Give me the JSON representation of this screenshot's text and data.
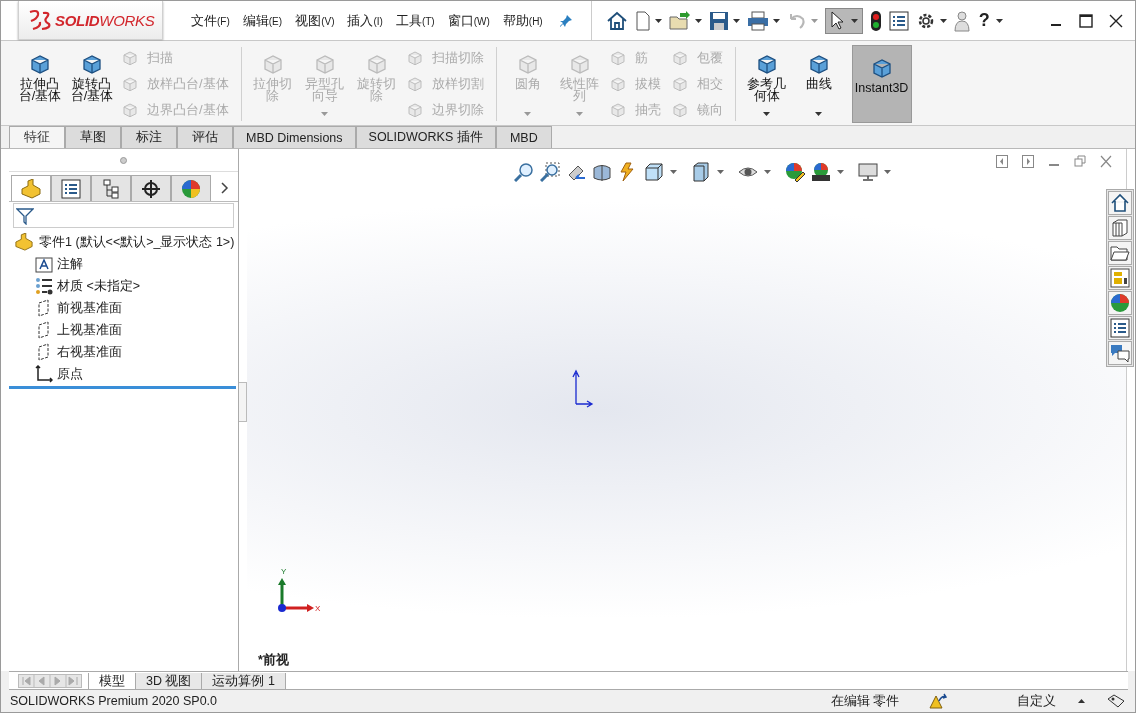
{
  "logo": "**SOLID**WORKS",
  "menu": [
    {
      "label": "文件",
      "key": "(F)"
    },
    {
      "label": "编辑",
      "key": "(E)"
    },
    {
      "label": "视图",
      "key": "(V)"
    },
    {
      "label": "插入",
      "key": "(I)"
    },
    {
      "label": "工具",
      "key": "(T)"
    },
    {
      "label": "窗口",
      "key": "(W)"
    },
    {
      "label": "帮助",
      "key": "(H)"
    }
  ],
  "quick_access": {
    "undo_disabled": true,
    "select_pressed": true,
    "help": "?"
  },
  "ribbon": [
    {
      "items": [
        {
          "kind": "large",
          "lines": [
            "拉伸凸",
            "台/基体"
          ],
          "disabled": false,
          "dropdown": false,
          "pressed": false
        },
        {
          "kind": "large",
          "lines": [
            "旋转凸",
            "台/基体"
          ],
          "disabled": false,
          "dropdown": false,
          "pressed": false
        },
        {
          "kind": "stack",
          "items": [
            {
              "label": "扫描",
              "disabled": true
            },
            {
              "label": "放样凸台/基体",
              "disabled": true
            },
            {
              "label": "边界凸台/基体",
              "disabled": true
            }
          ]
        }
      ]
    },
    {
      "items": [
        {
          "kind": "large",
          "lines": [
            "拉伸切",
            "除"
          ],
          "disabled": true,
          "dropdown": false,
          "pressed": false
        },
        {
          "kind": "large",
          "lines": [
            "异型孔",
            "向导"
          ],
          "disabled": true,
          "dropdown": true,
          "pressed": false
        },
        {
          "kind": "large",
          "lines": [
            "旋转切",
            "除"
          ],
          "disabled": true,
          "dropdown": false,
          "pressed": false
        },
        {
          "kind": "stack",
          "items": [
            {
              "label": "扫描切除",
              "disabled": true
            },
            {
              "label": "放样切割",
              "disabled": true
            },
            {
              "label": "边界切除",
              "disabled": true
            }
          ]
        }
      ]
    },
    {
      "items": [
        {
          "kind": "large",
          "lines": [
            "圆角"
          ],
          "disabled": true,
          "dropdown": true,
          "pressed": false
        },
        {
          "kind": "large",
          "lines": [
            "线性阵",
            "列"
          ],
          "disabled": true,
          "dropdown": true,
          "pressed": false
        },
        {
          "kind": "stack",
          "items": [
            {
              "label": "筋",
              "disabled": true
            },
            {
              "label": "拔模",
              "disabled": true
            },
            {
              "label": "抽壳",
              "disabled": true
            }
          ]
        },
        {
          "kind": "stack",
          "items": [
            {
              "label": "包覆",
              "disabled": true
            },
            {
              "label": "相交",
              "disabled": true
            },
            {
              "label": "镜向",
              "disabled": true
            }
          ]
        }
      ]
    },
    {
      "items": [
        {
          "kind": "large",
          "lines": [
            "参考几",
            "何体"
          ],
          "disabled": false,
          "dropdown": true,
          "pressed": false
        },
        {
          "kind": "large",
          "lines": [
            "曲线"
          ],
          "disabled": false,
          "dropdown": true,
          "pressed": false
        }
      ]
    },
    {
      "items": [
        {
          "kind": "large",
          "lines": [
            "Instant3D"
          ],
          "disabled": false,
          "dropdown": false,
          "pressed": true
        }
      ]
    }
  ],
  "tabs": [
    {
      "label": "特征",
      "selected": true
    },
    {
      "label": "草图",
      "selected": false
    },
    {
      "label": "标注",
      "selected": false
    },
    {
      "label": "评估",
      "selected": false
    },
    {
      "label": "MBD Dimensions",
      "selected": false
    },
    {
      "label": "SOLIDWORKS 插件",
      "selected": false
    },
    {
      "label": "MBD",
      "selected": false
    }
  ],
  "panel_tabs": [
    {
      "kind": "feature",
      "selected": true
    },
    {
      "kind": "property",
      "selected": false
    },
    {
      "kind": "config",
      "selected": false
    },
    {
      "kind": "dimxpert",
      "selected": false
    },
    {
      "kind": "display",
      "selected": false
    }
  ],
  "tree": {
    "label": "零件1  (默认<<默认>_显示状态 1>)",
    "children": [
      {
        "kind": "annotation",
        "label": "注解"
      },
      {
        "kind": "material",
        "label": "材质 <未指定>"
      },
      {
        "kind": "plane",
        "label": "前视基准面"
      },
      {
        "kind": "plane",
        "label": "上视基准面"
      },
      {
        "kind": "plane",
        "label": "右视基准面"
      },
      {
        "kind": "origin",
        "label": "原点"
      }
    ]
  },
  "viewport": {
    "view_label": "*前视",
    "triad": {
      "x": "X",
      "y": "Y"
    }
  },
  "bottom_tabs": [
    {
      "label": "模型",
      "selected": true
    },
    {
      "label": "3D 视图",
      "selected": false
    },
    {
      "label": "运动算例 1",
      "selected": false
    }
  ],
  "status_bar": {
    "product": "SOLIDWORKS Premium 2020 SP0.0",
    "mode": "在编辑 零件",
    "units": "自定义"
  }
}
